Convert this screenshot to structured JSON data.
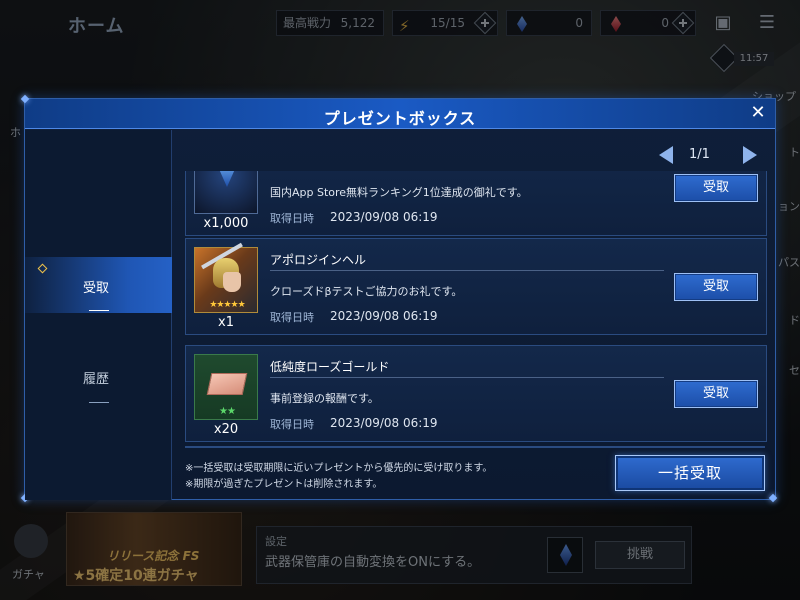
{
  "background": {
    "home_title": "ホーム",
    "max_power_label": "最高戦力",
    "max_power_value": "5,122",
    "stamina": "15/15",
    "blue_gems": "0",
    "red_gems": "0",
    "clock": "11:57",
    "shop_label": "ショップ",
    "side_right_fragments": [
      "ト",
      "ョン",
      "パス",
      "ド",
      "セ"
    ],
    "side_left_fragments": [
      "ホ"
    ],
    "gacha_label": "ガチャ",
    "banner_line1": "リリース記念 FS",
    "banner_line2": "★5確定10連ガチャ",
    "mission_title": "設定",
    "mission_desc": "武器保管庫の自動変換をONにする。",
    "challenge_label": "挑戦"
  },
  "modal": {
    "title": "プレゼントボックス",
    "close": "✕",
    "tabs": [
      {
        "label": "受取",
        "active": true
      },
      {
        "label": "履歴",
        "active": false
      }
    ],
    "pager": "1/1",
    "date_label": "取得日時",
    "receive_label": "受取",
    "items": [
      {
        "title": "",
        "desc": "国内App Store無料ランキング1位達成の御礼です。",
        "date": "2023/09/08 06:19",
        "qty": "x1,000",
        "icon": "crystal-icon"
      },
      {
        "title": "アポロジインヘル",
        "desc": "クローズドβテストご協力のお礼です。",
        "date": "2023/09/08 06:19",
        "qty": "x1",
        "stars": "★★★★★",
        "icon": "character-portrait"
      },
      {
        "title": "低純度ローズゴールド",
        "desc": "事前登録の報酬です。",
        "date": "2023/09/08 06:19",
        "qty": "x20",
        "stars": "★★",
        "icon": "rose-gold-ingot-icon"
      }
    ],
    "notes": [
      "※一括受取は受取期限に近いプレゼントから優先的に受け取ります。",
      "※期限が過ぎたプレゼントは削除されます。"
    ],
    "bulk_receive_label": "一括受取"
  },
  "colors": {
    "accent": "#1f56b4",
    "header": "#1a5ac4",
    "gold_stars": "#ffc83a",
    "green_stars": "#5bd66a"
  }
}
